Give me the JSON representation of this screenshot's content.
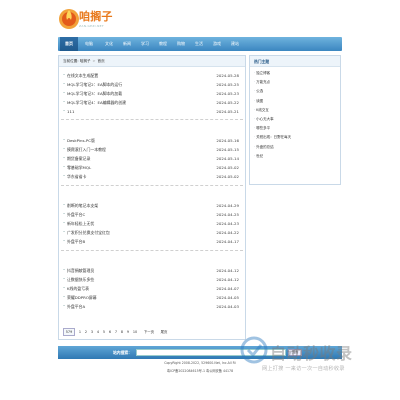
{
  "logo": {
    "name": "咱搁子",
    "sub": "ZAN.GEZI.NET"
  },
  "nav": [
    "首页",
    "电脑",
    "文化",
    "新闻",
    "学习",
    "教程",
    "购物",
    "生活",
    "游戏",
    "建站"
  ],
  "breadcrumb": {
    "label": "当前位置: 咱搁子",
    "current": "首页"
  },
  "groups": [
    [
      {
        "title": "在线文本生成配置",
        "date": "2024-05-28"
      },
      {
        "title": "MQL学习笔记2：EA脚本的运行",
        "date": "2024-05-25"
      },
      {
        "title": "MQL学习笔记3：EA脚本的加载",
        "date": "2024-05-23"
      },
      {
        "title": "MQL学习笔记4：EA编辑器的创建",
        "date": "2024-05-22"
      },
      {
        "title": "111",
        "date": "2024-05-21"
      }
    ],
    [
      {
        "title": "DeskPins-PC版",
        "date": "2024-05-16"
      },
      {
        "title": "摸爬滚打入门一本教程",
        "date": "2024-05-15"
      },
      {
        "title": "期货备案记录",
        "date": "2024-05-14"
      },
      {
        "title": "零基础学MQL",
        "date": "2024-05-02"
      },
      {
        "title": "华东省省卡",
        "date": "2024-05-02"
      }
    ],
    [
      {
        "title": "削断的笔记本支架",
        "date": "2024-04-29"
      },
      {
        "title": "外盘平台C",
        "date": "2024-04-25"
      },
      {
        "title": "新年轻松上无忧",
        "date": "2024-04-23"
      },
      {
        "title": "广发积分兑换支付宝红包",
        "date": "2024-04-22"
      },
      {
        "title": "外盘平台B",
        "date": "2024-04-17"
      }
    ],
    [
      {
        "title": "抖音捐献管理员",
        "date": "2024-04-12"
      },
      {
        "title": "让数据快乐多些",
        "date": "2024-04-12"
      },
      {
        "title": "K线的盈亏表",
        "date": "2024-04-07"
      },
      {
        "title": "荣耀DDPRO屏幕",
        "date": "2024-04-05"
      },
      {
        "title": "外盘平台A",
        "date": "2024-04-03"
      }
    ]
  ],
  "pager": {
    "count": "579",
    "pages": [
      "1",
      "2",
      "3",
      "4",
      "5",
      "6",
      "7",
      "8",
      "9",
      "10"
    ],
    "next": "下一页",
    "last": "尾页"
  },
  "sidebar": {
    "title": "热门主题",
    "items": [
      "独立博客",
      "万能充点",
      "公选",
      "读图",
      "K线交互",
      "小心无大事",
      "哪些多平",
      "关税出现：日野在每天",
      "外盘的总结",
      "世纪"
    ]
  },
  "footer": {
    "search_label": "站内搜索：",
    "search_button": "搜索",
    "copyright": "CopyRight 2008-2022, 529600.Net, Inc.All Ri",
    "beian": "粤ICP备2022084615号-1  粤公网安备 44178"
  },
  "watermark": {
    "name": "自动秒收录",
    "sub": "网上打搜 一来访一次一自动秒收录"
  }
}
